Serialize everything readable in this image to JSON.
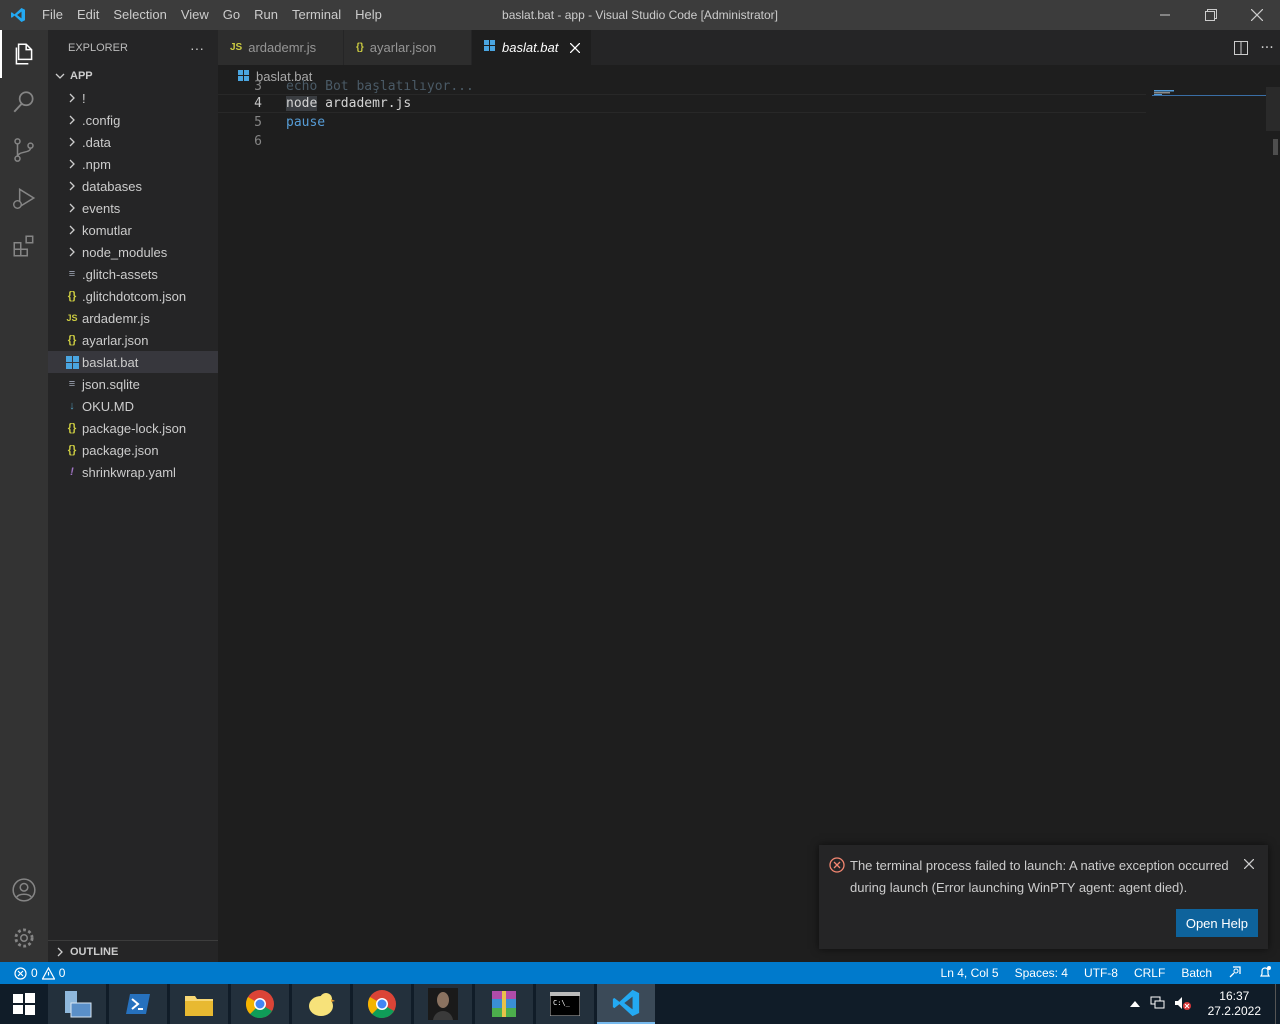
{
  "window": {
    "title": "baslat.bat - app - Visual Studio Code [Administrator]"
  },
  "menu": [
    "File",
    "Edit",
    "Selection",
    "View",
    "Go",
    "Run",
    "Terminal",
    "Help"
  ],
  "sidebar": {
    "header": "EXPLORER",
    "section": "APP",
    "folders": [
      "!",
      ".config",
      ".data",
      ".npm",
      "databases",
      "events",
      "komutlar",
      "node_modules"
    ],
    "files": [
      {
        "name": ".glitch-assets",
        "icon": "≡",
        "color": "#9da5b4"
      },
      {
        "name": ".glitchdotcom.json",
        "icon": "{}",
        "color": "#cbcb41"
      },
      {
        "name": "ardademr.js",
        "icon": "JS",
        "color": "#cbcb41"
      },
      {
        "name": "ayarlar.json",
        "icon": "{}",
        "color": "#cbcb41"
      },
      {
        "name": "baslat.bat",
        "icon": "win",
        "color": "#4aa5e0"
      },
      {
        "name": "json.sqlite",
        "icon": "≡",
        "color": "#9da5b4"
      },
      {
        "name": "OKU.MD",
        "icon": "↓",
        "color": "#519aba"
      },
      {
        "name": "package-lock.json",
        "icon": "{}",
        "color": "#cbcb41"
      },
      {
        "name": "package.json",
        "icon": "{}",
        "color": "#cbcb41"
      },
      {
        "name": "shrinkwrap.yaml",
        "icon": "!",
        "color": "#a074c4"
      }
    ],
    "outline": "OUTLINE"
  },
  "tabs": [
    {
      "label": "ardademr.js",
      "icon": "JS"
    },
    {
      "label": "ayarlar.json",
      "icon": "{}"
    },
    {
      "label": "baslat.bat",
      "icon": "win"
    }
  ],
  "breadcrumb": "baslat.bat",
  "editor": {
    "lines": [
      {
        "n": "3",
        "partial": "echo Bot başlatılıyor..."
      },
      {
        "n": "4",
        "kw": "node",
        "rest": " ardademr.js"
      },
      {
        "n": "5",
        "kw": "pause",
        "rest": ""
      },
      {
        "n": "6",
        "kw": "",
        "rest": ""
      }
    ]
  },
  "notification": {
    "message": "The terminal process failed to launch: A native exception occurred during launch (Error launching WinPTY agent: agent died).",
    "button": "Open Help"
  },
  "status": {
    "errors": "0",
    "warnings": "0",
    "position": "Ln 4, Col 5",
    "spaces": "Spaces: 4",
    "encoding": "UTF-8",
    "eol": "CRLF",
    "language": "Batch"
  },
  "taskbar": {
    "time": "16:37",
    "date": "27.2.2022"
  },
  "colors": {
    "accent": "#007acc",
    "error": "#f48771",
    "button": "#0e639c"
  }
}
